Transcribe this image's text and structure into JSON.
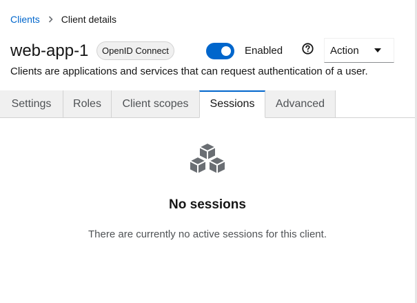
{
  "breadcrumb": {
    "parent": "Clients",
    "current": "Client details"
  },
  "header": {
    "title": "web-app-1",
    "protocol_badge": "OpenID Connect",
    "enabled_label": "Enabled",
    "enabled": true,
    "action_label": "Action",
    "description": "Clients are applications and services that can request authentication of a user."
  },
  "tabs": [
    {
      "label": "Settings",
      "active": false
    },
    {
      "label": "Roles",
      "active": false
    },
    {
      "label": "Client scopes",
      "active": false
    },
    {
      "label": "Sessions",
      "active": true
    },
    {
      "label": "Advanced",
      "active": false
    }
  ],
  "empty_state": {
    "icon": "cubes-icon",
    "title": "No sessions",
    "body": "There are currently no active sessions for this client."
  },
  "colors": {
    "accent": "#0066cc",
    "tab_inactive_bg": "#f0f0f0",
    "icon_gray": "#6a6e73"
  }
}
